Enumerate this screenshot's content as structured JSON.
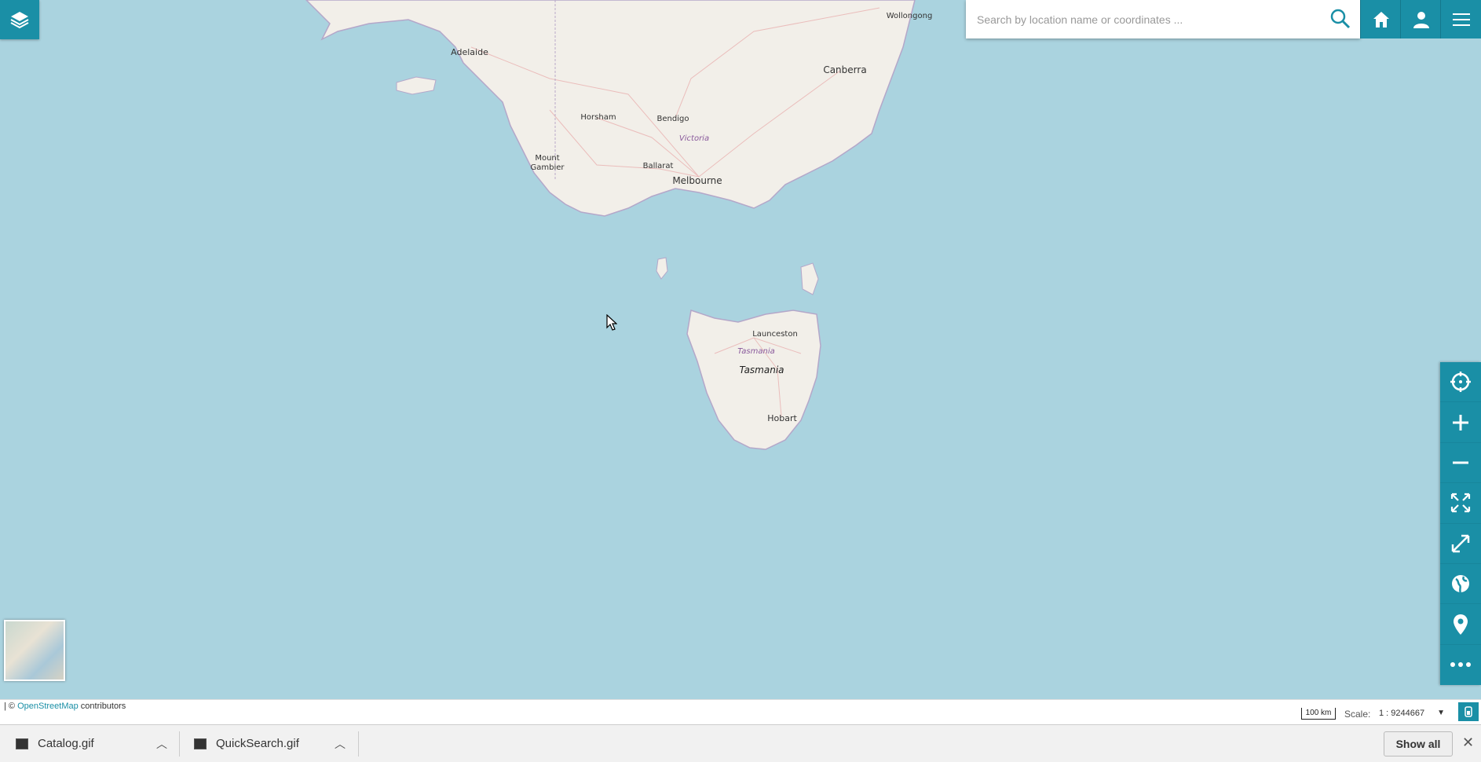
{
  "map": {
    "places": [
      {
        "name": "Adelaide"
      },
      {
        "name": "Wollongong"
      },
      {
        "name": "Canberra"
      },
      {
        "name": "Horsham"
      },
      {
        "name": "Bendigo"
      },
      {
        "name": "Victoria"
      },
      {
        "name": "Mount"
      },
      {
        "name": "Gambier"
      },
      {
        "name": "Ballarat"
      },
      {
        "name": "Melbourne"
      },
      {
        "name": "Launceston"
      },
      {
        "name": "Tasmania"
      },
      {
        "name": "Tasmania"
      },
      {
        "name": "Hobart"
      }
    ]
  },
  "search": {
    "placeholder": "Search by location name or coordinates ..."
  },
  "footer": {
    "attribution_prefix": "| © ",
    "attribution_link": "OpenStreetMap",
    "attribution_suffix": " contributors",
    "scalebar_label": "100 km",
    "scale_label": "Scale:",
    "scale_value": "1 : 9244667"
  },
  "downloads": {
    "items": [
      {
        "name": "Catalog.gif"
      },
      {
        "name": "QuickSearch.gif"
      }
    ],
    "show_all": "Show all"
  },
  "colors": {
    "accent": "#1a8fa6",
    "water": "#aad3df",
    "land": "#f2efe9"
  },
  "icons": {
    "layers": "layers-icon",
    "search": "search-icon",
    "home": "home-icon",
    "user": "user-icon",
    "menu": "menu-icon",
    "locate": "crosshair-icon",
    "zoom_in": "plus-icon",
    "zoom_out": "minus-icon",
    "fullscreen": "expand-icon",
    "extent": "diagonal-expand-icon",
    "globe": "globe-icon",
    "marker": "map-marker-icon",
    "more": "more-icon"
  }
}
